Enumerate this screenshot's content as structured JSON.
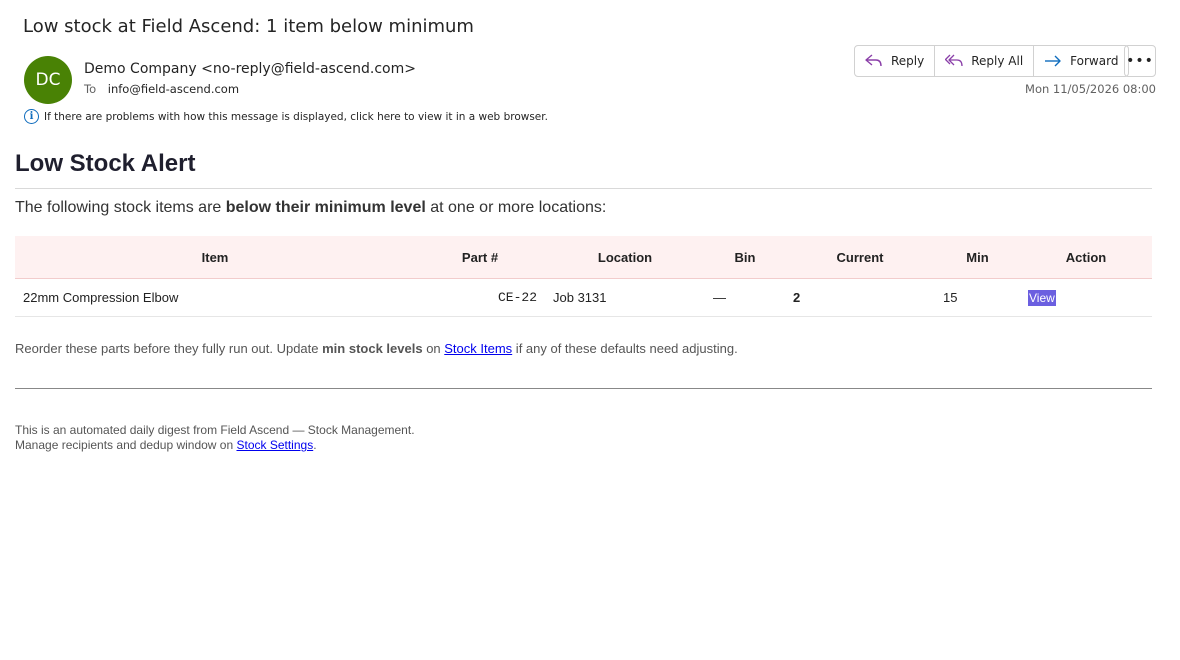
{
  "email": {
    "subject": "Low stock at Field Ascend: 1 item below minimum",
    "avatar_initials": "DC",
    "avatar_color": "#498205",
    "sender": "Demo Company <no-reply@field-ascend.com>",
    "to_label": "To",
    "to_address": "info@field-ascend.com",
    "info_notice": "If there are problems with how this message is displayed, click here to view it in a web browser.",
    "timestamp": "Mon 11/05/2026 08:00",
    "actions": {
      "reply": "Reply",
      "reply_all": "Reply All",
      "forward": "Forward",
      "more": "•••"
    }
  },
  "body": {
    "title": "Low Stock Alert",
    "intro_before": "The following stock items are ",
    "intro_bold": "below their minimum level",
    "intro_after": " at one or more locations:",
    "table": {
      "headers": [
        "Item",
        "Part #",
        "Location",
        "Bin",
        "Current",
        "Min",
        "Action"
      ],
      "rows": [
        {
          "item": "22mm Compression Elbow",
          "part": "CE-22",
          "location": "Job 3131",
          "bin": "—",
          "current": "2",
          "min": "15",
          "action": "View"
        }
      ]
    },
    "note_before": "Reorder these parts before they fully run out. Update ",
    "note_bold": "min stock levels",
    "note_mid": " on ",
    "note_link": "Stock Items",
    "note_after": " if any of these defaults need adjusting.",
    "footer_line1": "This is an automated daily digest from Field Ascend — Stock Management.",
    "footer_line2_before": "Manage recipients and dedup window on ",
    "footer_link": "Stock Settings",
    "footer_line2_after": "."
  },
  "colors": {
    "current_highlight": "#c2570c",
    "view_button": "#6b5fe0",
    "table_header_bg": "#fef1f1"
  }
}
